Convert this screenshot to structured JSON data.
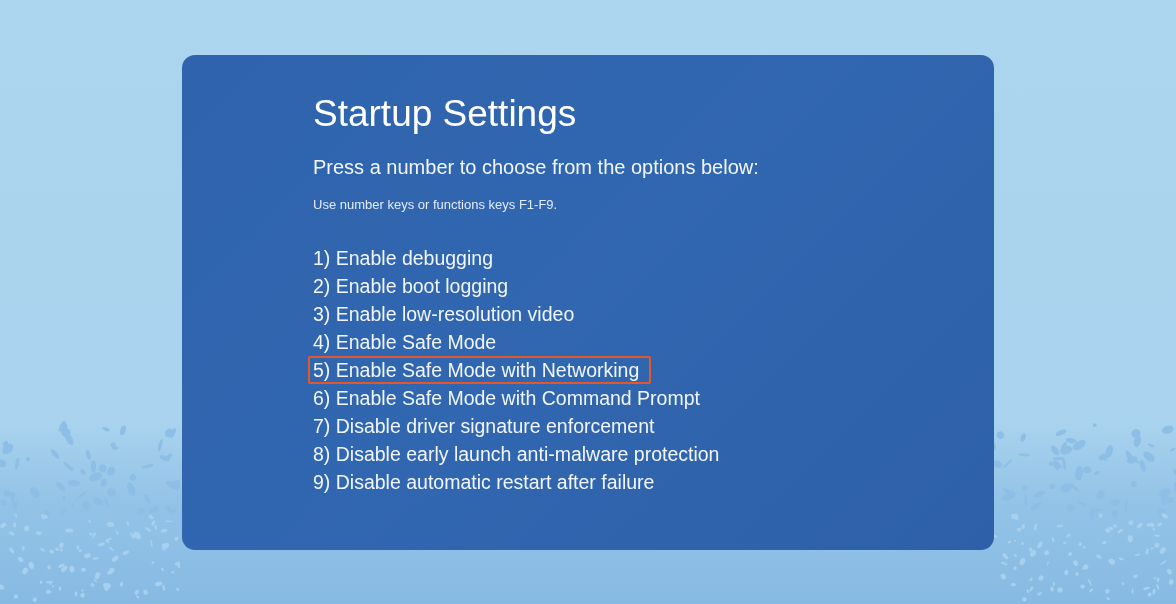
{
  "screen": {
    "title": "Startup Settings",
    "instruction": "Press a number to choose from the options below:",
    "hint": "Use number keys or functions keys F1-F9."
  },
  "options": [
    {
      "label": "1) Enable debugging",
      "highlighted": false
    },
    {
      "label": "2) Enable boot logging",
      "highlighted": false
    },
    {
      "label": "3) Enable low-resolution video",
      "highlighted": false
    },
    {
      "label": "4) Enable Safe Mode",
      "highlighted": false
    },
    {
      "label": "5) Enable Safe Mode with Networking",
      "highlighted": true
    },
    {
      "label": "6) Enable Safe Mode with Command Prompt",
      "highlighted": false
    },
    {
      "label": "7) Disable driver signature enforcement",
      "highlighted": false
    },
    {
      "label": "8) Disable early launch anti-malware protection",
      "highlighted": false
    },
    {
      "label": "9) Disable automatic restart after failure",
      "highlighted": false
    }
  ]
}
